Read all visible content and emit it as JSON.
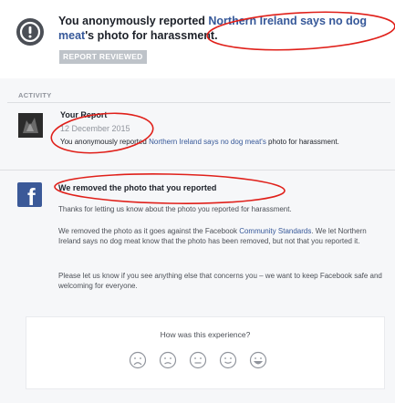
{
  "header": {
    "text_before": "You anonymously reported ",
    "link_text": "Northern Ireland says no dog meat",
    "text_after": "'s photo for harassment.",
    "badge": "REPORT REVIEWED",
    "icon": "exclamation-icon"
  },
  "activity": {
    "label": "ACTIVITY",
    "report": {
      "title": "Your Report",
      "date": "12 December 2015",
      "desc_before": "You anonymously reported ",
      "desc_link": "Northern Ireland says no dog meat's",
      "desc_after": " photo for harassment."
    },
    "message": {
      "title": "We removed the photo that you reported",
      "p1": "Thanks for letting us know about the photo you reported for harassment.",
      "p2_before": "We removed the photo as it goes against the Facebook ",
      "p2_link": "Community Standards",
      "p2_after": ". We let Northern Ireland says no dog meat know that the photo has been removed, but not that you reported it.",
      "p3": "Please let us know if you see anything else that concerns you – we want to keep Facebook safe and welcoming for everyone.",
      "logo": "f"
    }
  },
  "feedback": {
    "question": "How was this experience?",
    "faces": [
      "very-sad-face-icon",
      "sad-face-icon",
      "neutral-face-icon",
      "happy-face-icon",
      "very-happy-face-icon"
    ]
  },
  "colors": {
    "link": "#365899",
    "annotation_red": "#e0201a",
    "facebook_blue": "#3b5998"
  }
}
